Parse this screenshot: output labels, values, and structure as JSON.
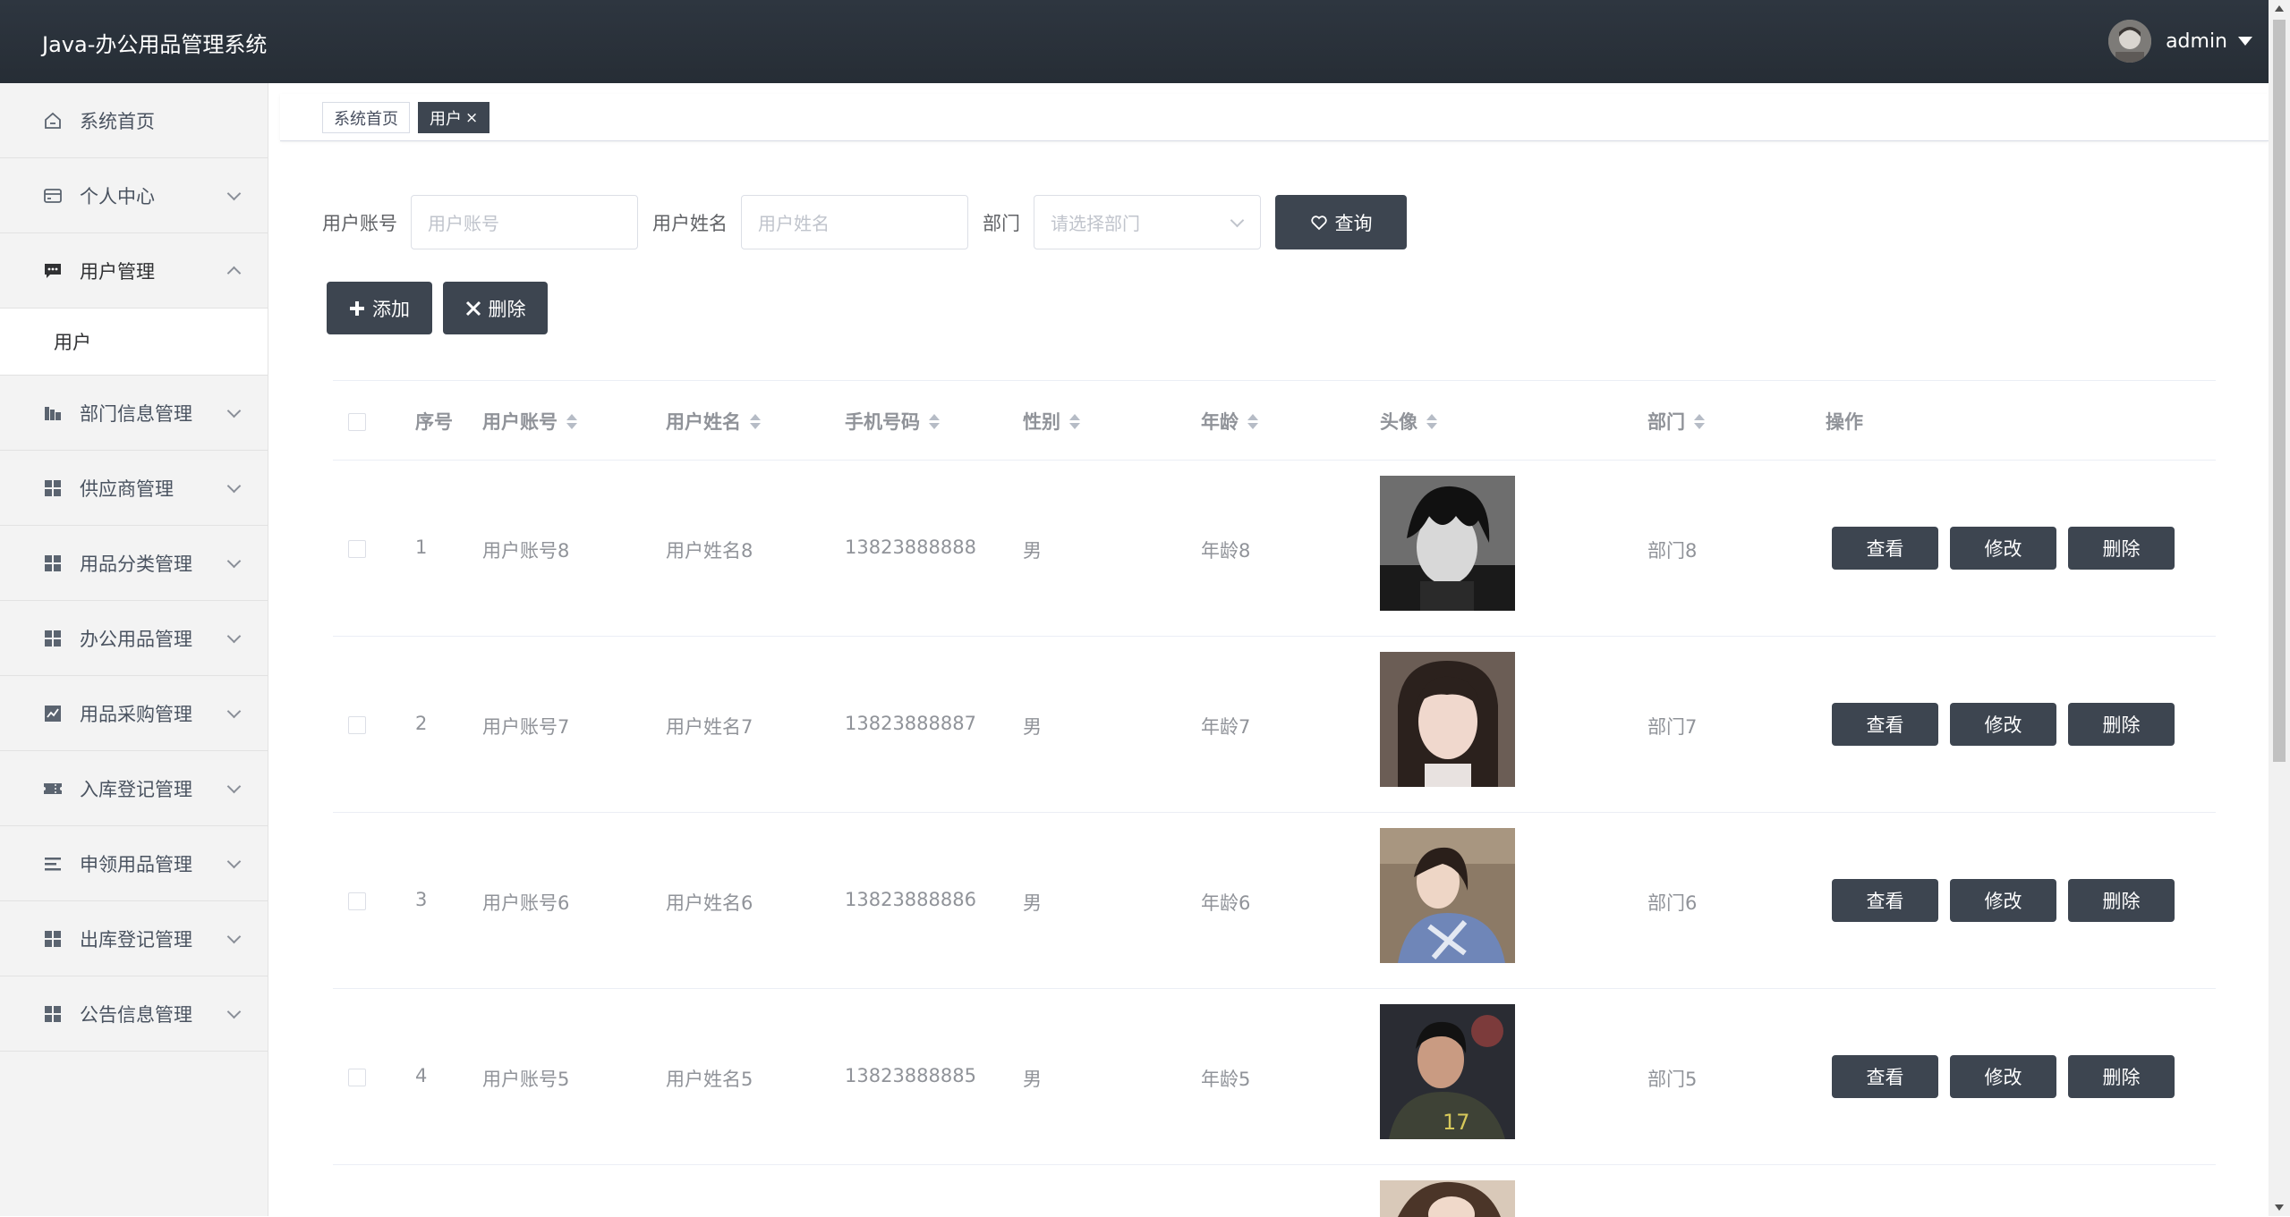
{
  "header": {
    "title": "Java-办公用品管理系统",
    "username": "admin"
  },
  "sidebar": {
    "items": [
      {
        "label": "系统首页",
        "icon": "home-icon"
      },
      {
        "label": "个人中心",
        "icon": "card-icon"
      },
      {
        "label": "用户管理",
        "icon": "chat-icon",
        "expanded": true,
        "sub": [
          {
            "label": "用户"
          }
        ]
      },
      {
        "label": "部门信息管理",
        "icon": "building-icon"
      },
      {
        "label": "供应商管理",
        "icon": "grid-icon"
      },
      {
        "label": "用品分类管理",
        "icon": "grid-icon"
      },
      {
        "label": "办公用品管理",
        "icon": "grid-icon"
      },
      {
        "label": "用品采购管理",
        "icon": "chart-icon"
      },
      {
        "label": "入库登记管理",
        "icon": "ticket-icon"
      },
      {
        "label": "申领用品管理",
        "icon": "list-icon"
      },
      {
        "label": "出库登记管理",
        "icon": "grid-icon"
      },
      {
        "label": "公告信息管理",
        "icon": "grid-icon"
      }
    ]
  },
  "tabs": [
    {
      "label": "系统首页"
    },
    {
      "label": "用户",
      "close": "×"
    }
  ],
  "search": {
    "account_label": "用户账号",
    "account_placeholder": "用户账号",
    "name_label": "用户姓名",
    "name_placeholder": "用户姓名",
    "dept_label": "部门",
    "dept_placeholder": "请选择部门",
    "query_button": "查询"
  },
  "actions": {
    "add_button": "添加",
    "delete_button": "删除"
  },
  "table": {
    "columns": {
      "index": "序号",
      "account": "用户账号",
      "name": "用户姓名",
      "phone": "手机号码",
      "gender": "性别",
      "age": "年龄",
      "avatar": "头像",
      "dept": "部门",
      "ops": "操作"
    },
    "op_labels": {
      "view": "查看",
      "edit": "修改",
      "delete": "删除"
    },
    "rows": [
      {
        "index": "1",
        "account": "用户账号8",
        "name": "用户姓名8",
        "phone": "13823888888",
        "gender": "男",
        "age": "年龄8",
        "dept": "部门8"
      },
      {
        "index": "2",
        "account": "用户账号7",
        "name": "用户姓名7",
        "phone": "13823888887",
        "gender": "男",
        "age": "年龄7",
        "dept": "部门7"
      },
      {
        "index": "3",
        "account": "用户账号6",
        "name": "用户姓名6",
        "phone": "13823888886",
        "gender": "男",
        "age": "年龄6",
        "dept": "部门6"
      },
      {
        "index": "4",
        "account": "用户账号5",
        "name": "用户姓名5",
        "phone": "13823888885",
        "gender": "男",
        "age": "年龄5",
        "dept": "部门5"
      }
    ]
  }
}
